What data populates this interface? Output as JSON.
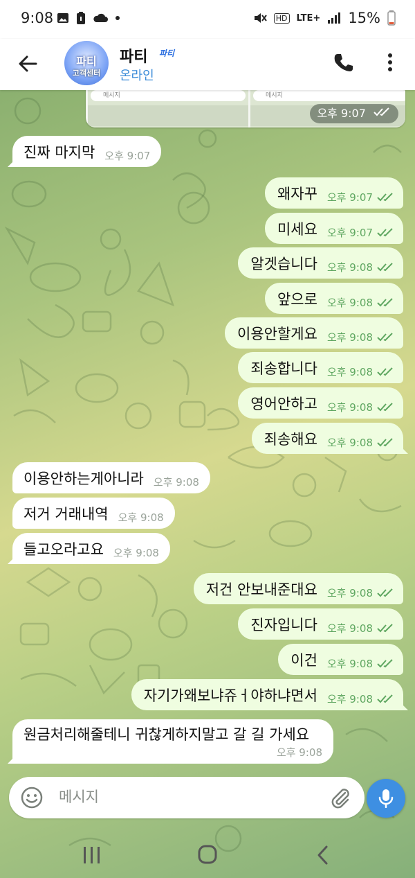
{
  "status_bar": {
    "time": "9:08",
    "network": "LTE+",
    "hd": "HD",
    "battery": "15%"
  },
  "header": {
    "avatar_title": "파티",
    "avatar_subtitle": "고객센터",
    "name": "파티",
    "badge": "파티",
    "status": "온라인"
  },
  "preview": {
    "left_input_placeholder": "메시지",
    "right_input_placeholder": "메시지",
    "time": "오후 9:07"
  },
  "messages": [
    {
      "dir": "in",
      "text": "진짜 마지막",
      "time": "오후 9:07"
    },
    {
      "dir": "out",
      "text": "왜자꾸",
      "time": "오후 9:07"
    },
    {
      "dir": "out",
      "text": "미세요",
      "time": "오후 9:07"
    },
    {
      "dir": "out",
      "text": "알겟습니다",
      "time": "오후 9:08"
    },
    {
      "dir": "out",
      "text": "앞으로",
      "time": "오후 9:08"
    },
    {
      "dir": "out",
      "text": "이용안할게요",
      "time": "오후 9:08"
    },
    {
      "dir": "out",
      "text": "죄송합니다",
      "time": "오후 9:08"
    },
    {
      "dir": "out",
      "text": "영어안하고",
      "time": "오후 9:08"
    },
    {
      "dir": "out",
      "text": "죄송해요",
      "time": "오후 9:08"
    },
    {
      "dir": "in",
      "text": "이용안하는게아니라",
      "time": "오후 9:08"
    },
    {
      "dir": "in",
      "text": "저거 거래내역",
      "time": "오후 9:08"
    },
    {
      "dir": "in",
      "text": "들고오라고요",
      "time": "오후 9:08"
    },
    {
      "dir": "out",
      "text": "저건 안보내준대요",
      "time": "오후 9:08"
    },
    {
      "dir": "out",
      "text": "진자입니다",
      "time": "오후 9:08"
    },
    {
      "dir": "out",
      "text": "이건",
      "time": "오후 9:08"
    },
    {
      "dir": "out",
      "text": "자기가왜보냐쥬ㅓ야하냐면서",
      "time": "오후 9:08"
    },
    {
      "dir": "in",
      "text": "원금처리해줄테니 귀찮게하지말고 갈 길 가세요",
      "time": "오후 9:08"
    }
  ],
  "composer": {
    "placeholder": "메시지"
  },
  "icons": {
    "back": "arrow-left-icon",
    "call": "phone-icon",
    "menu": "more-vertical-icon",
    "emoji": "smiley-icon",
    "attach": "paperclip-icon",
    "mic": "microphone-icon"
  },
  "colors": {
    "outgoing_bubble": "#effde0",
    "incoming_bubble": "#ffffff",
    "read_check": "#5fa761",
    "status_online": "#3a8bd8",
    "mic_button": "#3e8fe2"
  }
}
